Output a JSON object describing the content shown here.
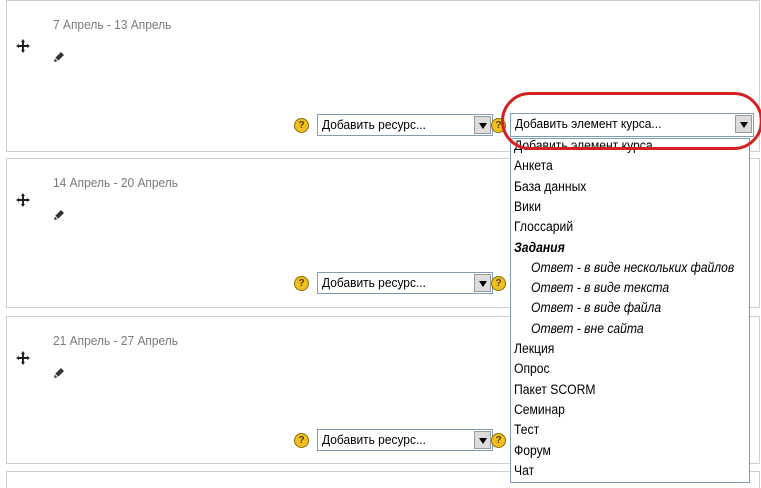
{
  "sections": [
    {
      "title": "7 Апрель - 13 Апрель"
    },
    {
      "title": "14 Апрель - 20 Апрель"
    },
    {
      "title": "21 Апрель - 27 Апрель"
    }
  ],
  "add_resource_label": "Добавить ресурс...",
  "add_activity_label": "Добавить элемент курса...",
  "dropdown_options": [
    {
      "label": "Добавить элемент курса...",
      "kind": "header"
    },
    {
      "label": "Анкета",
      "kind": "item"
    },
    {
      "label": "База данных",
      "kind": "item"
    },
    {
      "label": "Вики",
      "kind": "item"
    },
    {
      "label": "Глоссарий",
      "kind": "item"
    },
    {
      "label": "Задания",
      "kind": "group"
    },
    {
      "label": "Ответ - в виде нескольких файлов",
      "kind": "sub"
    },
    {
      "label": "Ответ - в виде текста",
      "kind": "sub"
    },
    {
      "label": "Ответ - в виде файла",
      "kind": "sub"
    },
    {
      "label": "Ответ - вне сайта",
      "kind": "sub"
    },
    {
      "label": "Лекция",
      "kind": "item"
    },
    {
      "label": "Опрос",
      "kind": "item"
    },
    {
      "label": "Пакет SCORM",
      "kind": "item"
    },
    {
      "label": "Семинар",
      "kind": "item"
    },
    {
      "label": "Тест",
      "kind": "item"
    },
    {
      "label": "Форум",
      "kind": "item"
    },
    {
      "label": "Чат",
      "kind": "item"
    }
  ],
  "help_glyph": "?",
  "highlight_color": "#d42020"
}
